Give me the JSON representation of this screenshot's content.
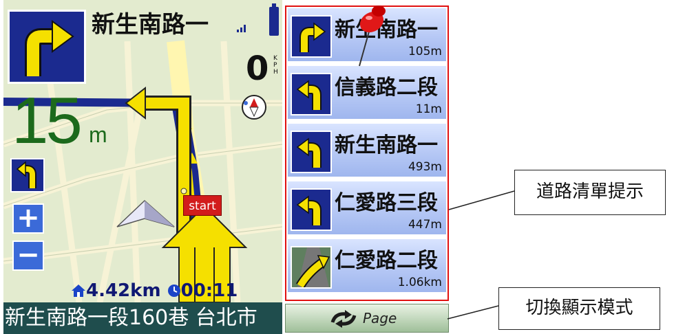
{
  "nav": {
    "current_road": "新生南路一",
    "speed": "0",
    "speed_unit": "KPH",
    "turn_distance": "15",
    "turn_distance_unit": "m",
    "zoom_in_label": "+",
    "zoom_out_label": "−",
    "start_label": "start",
    "remaining_distance": "4.42km",
    "remaining_time": "00:11",
    "address": "新生南路一段160巷 台北市"
  },
  "route_list": {
    "items": [
      {
        "name": "新生南路一",
        "distance": "105m",
        "icon": "turn-right-icon"
      },
      {
        "name": "信義路二段",
        "distance": "11m",
        "icon": "turn-left-icon"
      },
      {
        "name": "新生南路一",
        "distance": "493m",
        "icon": "turn-left-icon"
      },
      {
        "name": "仁愛路三段",
        "distance": "447m",
        "icon": "turn-left-icon"
      },
      {
        "name": "仁愛路二段",
        "distance": "1.06km",
        "icon": "lane-merge-icon"
      }
    ]
  },
  "page_button": {
    "label": "Page",
    "icon": "cycle-arrows-icon"
  },
  "annotations": {
    "route_list_hint": "道路清單提示",
    "switch_mode": "切換顯示模式"
  },
  "colors": {
    "route_blue": "#1b2a8f",
    "route_highlight": "#f5e000",
    "distance_green": "#1c6a1c",
    "list_border_red": "#e01010",
    "address_bar": "#1f4d4d"
  }
}
